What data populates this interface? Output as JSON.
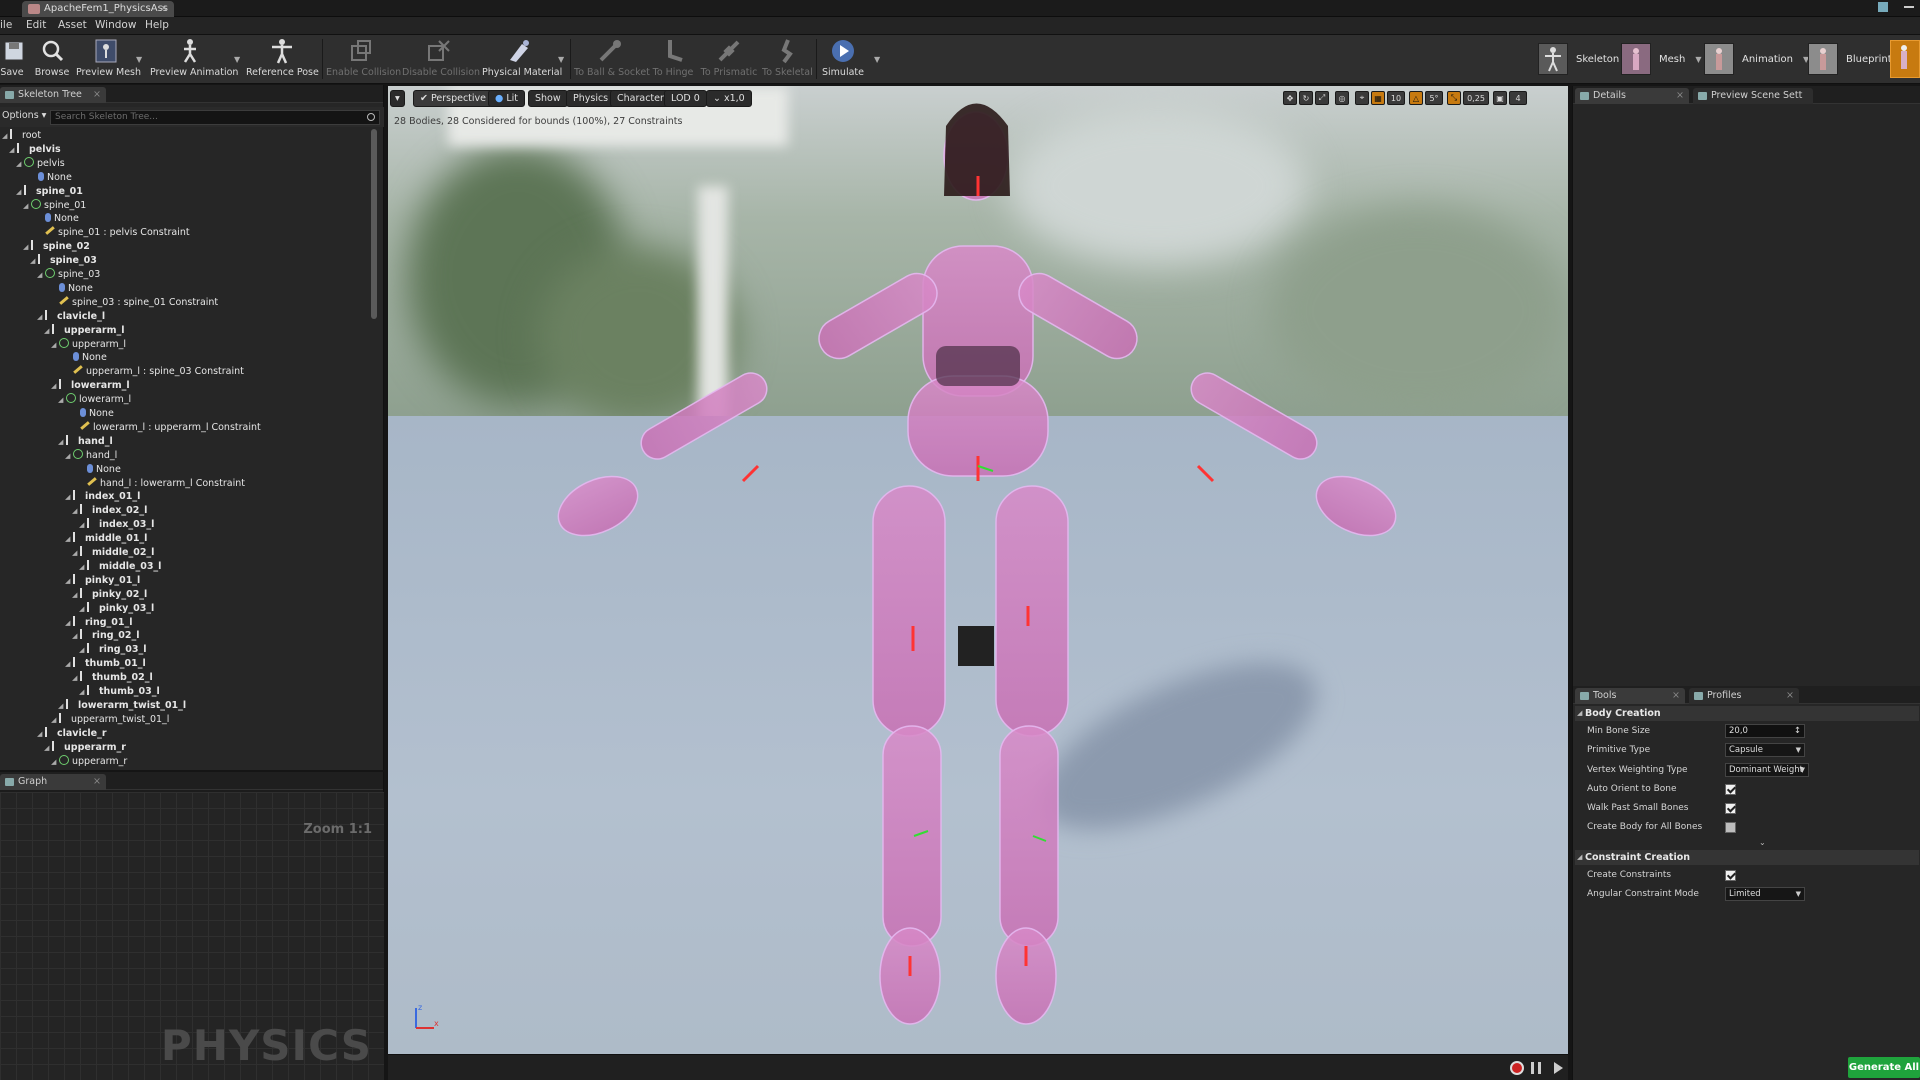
{
  "window": {
    "doc_tab": "ApacheFem1_PhysicsAss"
  },
  "menu": [
    "ile",
    "Edit",
    "Asset",
    "Window",
    "Help"
  ],
  "toolbar": {
    "save": "Save",
    "browse": "Browse",
    "preview_mesh": "Preview Mesh",
    "preview_animation": "Preview Animation",
    "reference_pose": "Reference Pose",
    "enable_collision": "Enable Collision",
    "disable_collision": "Disable Collision",
    "physical_material": "Physical Material",
    "to_ball_socket": "To Ball & Socket",
    "to_hinge": "To Hinge",
    "to_prismatic": "To Prismatic",
    "to_skeletal": "To Skeletal",
    "simulate": "Simulate"
  },
  "modes": {
    "skeleton": "Skeleton",
    "mesh": "Mesh",
    "animation": "Animation",
    "blueprint": "Blueprint"
  },
  "skeleton_tree": {
    "tab": "Skeleton Tree",
    "options": "Options",
    "search_placeholder": "Search Skeleton Tree...",
    "rows": [
      {
        "t": "root",
        "type": "bone",
        "d": 0,
        "bold": false
      },
      {
        "t": "pelvis",
        "type": "bone",
        "d": 1,
        "bold": true
      },
      {
        "t": "pelvis",
        "type": "body",
        "d": 2,
        "bold": false
      },
      {
        "t": "None",
        "type": "none",
        "d": 4,
        "bold": false
      },
      {
        "t": "spine_01",
        "type": "bone",
        "d": 2,
        "bold": true
      },
      {
        "t": "spine_01",
        "type": "body",
        "d": 3,
        "bold": false
      },
      {
        "t": "None",
        "type": "none",
        "d": 5,
        "bold": false
      },
      {
        "t": "spine_01 : pelvis Constraint",
        "type": "con",
        "d": 5,
        "bold": false
      },
      {
        "t": "spine_02",
        "type": "bone",
        "d": 3,
        "bold": true
      },
      {
        "t": "spine_03",
        "type": "bone",
        "d": 4,
        "bold": true
      },
      {
        "t": "spine_03",
        "type": "body",
        "d": 5,
        "bold": false
      },
      {
        "t": "None",
        "type": "none",
        "d": 7,
        "bold": false
      },
      {
        "t": "spine_03 : spine_01 Constraint",
        "type": "con",
        "d": 7,
        "bold": false
      },
      {
        "t": "clavicle_l",
        "type": "bone",
        "d": 5,
        "bold": true
      },
      {
        "t": "upperarm_l",
        "type": "bone",
        "d": 6,
        "bold": true
      },
      {
        "t": "upperarm_l",
        "type": "body",
        "d": 7,
        "bold": false
      },
      {
        "t": "None",
        "type": "none",
        "d": 9,
        "bold": false
      },
      {
        "t": "upperarm_l : spine_03 Constraint",
        "type": "con",
        "d": 9,
        "bold": false
      },
      {
        "t": "lowerarm_l",
        "type": "bone",
        "d": 7,
        "bold": true
      },
      {
        "t": "lowerarm_l",
        "type": "body",
        "d": 8,
        "bold": false
      },
      {
        "t": "None",
        "type": "none",
        "d": 10,
        "bold": false
      },
      {
        "t": "lowerarm_l : upperarm_l Constraint",
        "type": "con",
        "d": 10,
        "bold": false
      },
      {
        "t": "hand_l",
        "type": "bone",
        "d": 8,
        "bold": true
      },
      {
        "t": "hand_l",
        "type": "body",
        "d": 9,
        "bold": false
      },
      {
        "t": "None",
        "type": "none",
        "d": 11,
        "bold": false
      },
      {
        "t": "hand_l : lowerarm_l Constraint",
        "type": "con",
        "d": 11,
        "bold": false
      },
      {
        "t": "index_01_l",
        "type": "bone",
        "d": 9,
        "bold": true
      },
      {
        "t": "index_02_l",
        "type": "bone",
        "d": 10,
        "bold": true
      },
      {
        "t": "index_03_l",
        "type": "bone",
        "d": 11,
        "bold": true
      },
      {
        "t": "middle_01_l",
        "type": "bone",
        "d": 9,
        "bold": true
      },
      {
        "t": "middle_02_l",
        "type": "bone",
        "d": 10,
        "bold": true
      },
      {
        "t": "middle_03_l",
        "type": "bone",
        "d": 11,
        "bold": true
      },
      {
        "t": "pinky_01_l",
        "type": "bone",
        "d": 9,
        "bold": true
      },
      {
        "t": "pinky_02_l",
        "type": "bone",
        "d": 10,
        "bold": true
      },
      {
        "t": "pinky_03_l",
        "type": "bone",
        "d": 11,
        "bold": true
      },
      {
        "t": "ring_01_l",
        "type": "bone",
        "d": 9,
        "bold": true
      },
      {
        "t": "ring_02_l",
        "type": "bone",
        "d": 10,
        "bold": true
      },
      {
        "t": "ring_03_l",
        "type": "bone",
        "d": 11,
        "bold": true
      },
      {
        "t": "thumb_01_l",
        "type": "bone",
        "d": 9,
        "bold": true
      },
      {
        "t": "thumb_02_l",
        "type": "bone",
        "d": 10,
        "bold": true
      },
      {
        "t": "thumb_03_l",
        "type": "bone",
        "d": 11,
        "bold": true
      },
      {
        "t": "lowerarm_twist_01_l",
        "type": "bone",
        "d": 8,
        "bold": true
      },
      {
        "t": "upperarm_twist_01_l",
        "type": "bone",
        "d": 7,
        "bold": false
      },
      {
        "t": "clavicle_r",
        "type": "bone",
        "d": 5,
        "bold": true
      },
      {
        "t": "upperarm_r",
        "type": "bone",
        "d": 6,
        "bold": true
      },
      {
        "t": "upperarm_r",
        "type": "body",
        "d": 7,
        "bold": false
      }
    ]
  },
  "graph": {
    "tab": "Graph",
    "zoom": "Zoom 1:1",
    "watermark": "PHYSICS"
  },
  "viewport": {
    "perspective": "Perspective",
    "lit": "Lit",
    "show": "Show",
    "physics": "Physics",
    "character": "Character",
    "lod": "LOD 0",
    "speed": "x1,0",
    "stats": "28 Bodies, 28 Considered for bounds (100%), 27 Constraints",
    "grid_size": "10",
    "angle": "5°",
    "scale": "0,25",
    "cam_speed": "4"
  },
  "details": {
    "tab_details": "Details",
    "tab_preview": "Preview Scene Sett"
  },
  "tools": {
    "tab_tools": "Tools",
    "tab_profiles": "Profiles",
    "body_creation": "Body Creation",
    "min_bone_size_label": "Min Bone Size",
    "min_bone_size": "20,0",
    "primitive_type_label": "Primitive Type",
    "primitive_type": "Capsule",
    "vertex_weighting_label": "Vertex Weighting Type",
    "vertex_weighting": "Dominant Weight",
    "auto_orient_label": "Auto Orient to Bone",
    "walk_past_label": "Walk Past Small Bones",
    "create_body_all_label": "Create Body for All Bones",
    "constraint_creation": "Constraint Creation",
    "create_constraints_label": "Create Constraints",
    "angular_mode_label": "Angular Constraint Mode",
    "angular_mode": "Limited",
    "generate_all": "Generate All"
  },
  "colors": {
    "accent_orange": "#c77a10",
    "generate_green": "#1fa33c",
    "body_pink": "#d07ad8"
  }
}
